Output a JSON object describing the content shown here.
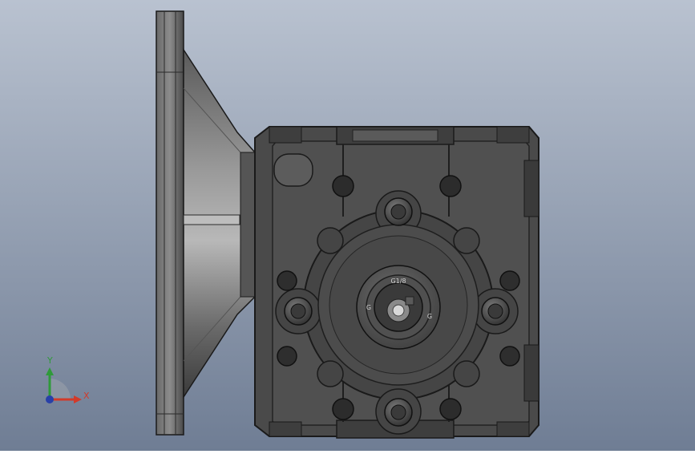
{
  "scene": {
    "background_top": "#b9c2d0",
    "background_bottom": "#6f7d94",
    "model": "worm-gear-reducer",
    "body_color": "#4a4a4a",
    "edge_color": "#1a1a1a"
  },
  "part_markings": {
    "top": "G1/8",
    "left": "G",
    "right": "G"
  },
  "triad": {
    "x_label": "X",
    "y_label": "Y",
    "x_color": "#d23a2a",
    "y_color": "#2f9a3a",
    "z_color": "#2840a8"
  }
}
